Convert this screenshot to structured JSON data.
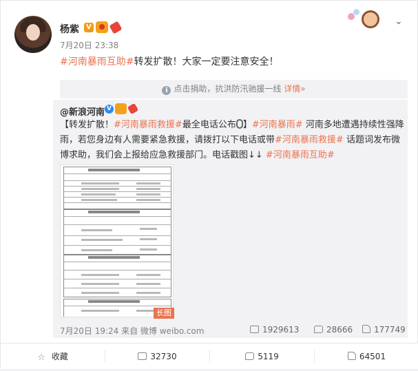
{
  "header": {
    "username": "杨紫",
    "verified_badge": "V",
    "post_time": "7月20日 23:38",
    "more_icon": "chevron-down-icon"
  },
  "post": {
    "hashtag": "#河南暴雨互助#",
    "text": "转发扩散！大家一定要注意安全！"
  },
  "notice": {
    "icon": "info-icon",
    "text": "点击捐助，抗洪防汛驰援一线",
    "link": "详情»"
  },
  "repost": {
    "author": "@新浪河南",
    "verified_badge": "V",
    "text": {
      "p1": "【转发扩散！",
      "tag1": "#河南暴雨救援#",
      "p2": "最全电话公布",
      "p3": "】",
      "tag2": "#河南暴雨#",
      "p4": " 河南多地遭遇持续性强降雨，若您身边有人需要紧急救援，请拨打以下电话或带",
      "tag3": "#河南暴雨救援#",
      "p5": " 话题词发布微博求助，我们会上报给应急救援部门。电话戳图↓↓ ",
      "tag4": "#河南暴雨互助#"
    },
    "image_badge": "长图",
    "footer": "7月20日 19:24 来自 微博 weibo.com",
    "stats": {
      "reposts": "1929613",
      "comments": "28666",
      "likes": "177749"
    }
  },
  "actions": {
    "favorite": "收藏",
    "repost": "32730",
    "comment": "5119",
    "like": "64501"
  },
  "colors": {
    "accent": "#eb7350",
    "text": "#333333",
    "muted": "#808080",
    "panel": "#f2f2f5"
  }
}
